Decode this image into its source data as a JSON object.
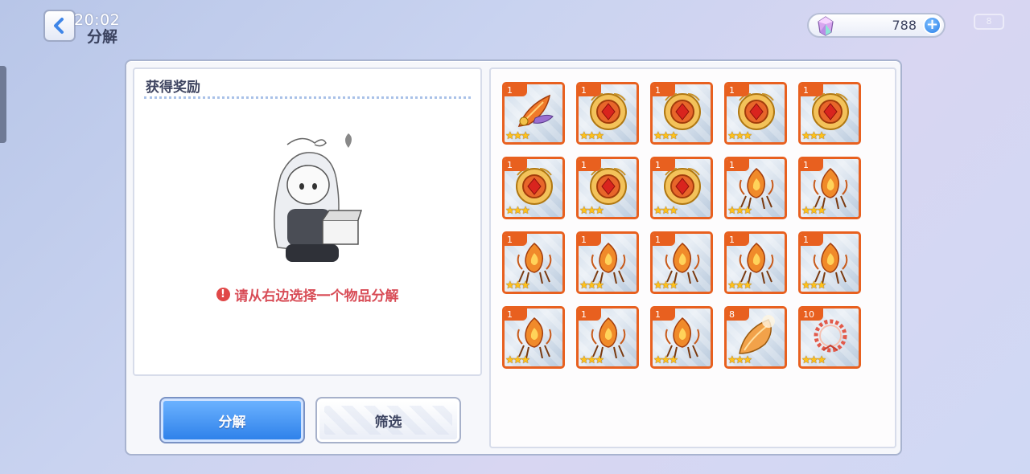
{
  "header": {
    "clock": "20:02",
    "title": "分解",
    "currency_amount": "788",
    "battery": "8"
  },
  "reward_panel": {
    "title": "获得奖励",
    "hint": "请从右边选择一个物品分解"
  },
  "buttons": {
    "decompose_label": "分解",
    "filter_label": "筛选"
  },
  "items": [
    {
      "count": "1",
      "icon": "feather-icon",
      "stars": "★★★"
    },
    {
      "count": "1",
      "icon": "gem-amulet-icon",
      "stars": "★★★"
    },
    {
      "count": "1",
      "icon": "gem-amulet-icon",
      "stars": "★★★"
    },
    {
      "count": "1",
      "icon": "gem-amulet-icon",
      "stars": "★★★"
    },
    {
      "count": "1",
      "icon": "gem-amulet-icon",
      "stars": "★★★"
    },
    {
      "count": "1",
      "icon": "gem-amulet-icon",
      "stars": "★★★"
    },
    {
      "count": "1",
      "icon": "gem-amulet-icon",
      "stars": "★★★"
    },
    {
      "count": "1",
      "icon": "gem-amulet-icon",
      "stars": "★★★"
    },
    {
      "count": "1",
      "icon": "flame-charm-icon",
      "stars": "★★★"
    },
    {
      "count": "1",
      "icon": "flame-charm-icon",
      "stars": "★★★"
    },
    {
      "count": "1",
      "icon": "flame-charm-icon",
      "stars": "★★★"
    },
    {
      "count": "1",
      "icon": "flame-charm-icon",
      "stars": "★★★"
    },
    {
      "count": "1",
      "icon": "flame-charm-icon",
      "stars": "★★★"
    },
    {
      "count": "1",
      "icon": "flame-charm-icon",
      "stars": "★★★"
    },
    {
      "count": "1",
      "icon": "flame-charm-icon",
      "stars": "★★★"
    },
    {
      "count": "1",
      "icon": "flame-charm-icon",
      "stars": "★★★"
    },
    {
      "count": "1",
      "icon": "flame-charm-icon",
      "stars": "★★★"
    },
    {
      "count": "1",
      "icon": "flame-charm-icon",
      "stars": "★★★"
    },
    {
      "count": "8",
      "icon": "horn-shell-icon",
      "stars": "★★★"
    },
    {
      "count": "10",
      "icon": "laurel-wreath-icon",
      "stars": "★★★"
    }
  ],
  "colors": {
    "item_border": "#e8601f",
    "hint": "#d84c56",
    "primary_button": "#2f82ea"
  }
}
